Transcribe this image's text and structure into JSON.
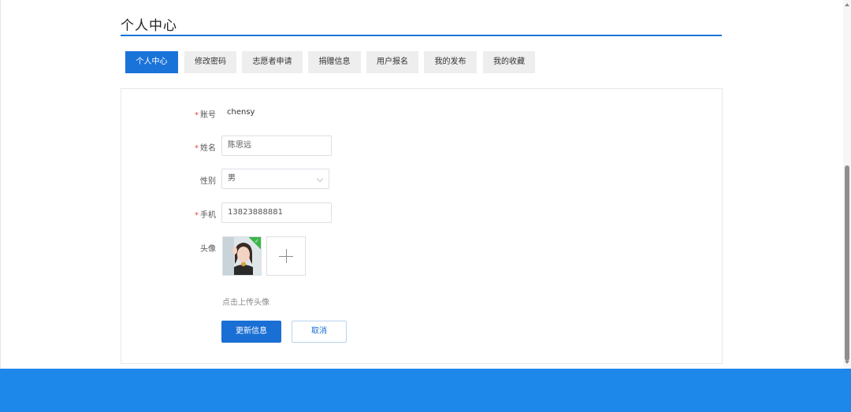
{
  "page": {
    "title": "个人中心"
  },
  "tabs": [
    {
      "label": "个人中心",
      "active": true
    },
    {
      "label": "修改密码",
      "active": false
    },
    {
      "label": "志愿者申请",
      "active": false
    },
    {
      "label": "捐赠信息",
      "active": false
    },
    {
      "label": "用户报名",
      "active": false
    },
    {
      "label": "我的发布",
      "active": false
    },
    {
      "label": "我的收藏",
      "active": false
    }
  ],
  "form": {
    "required_mark": "*",
    "account": {
      "label": "账号",
      "value": "chensy"
    },
    "name": {
      "label": "姓名",
      "value": "陈思远"
    },
    "gender": {
      "label": "性别",
      "value": "男"
    },
    "phone": {
      "label": "手机",
      "value": "13823888881"
    },
    "avatar": {
      "label": "头像",
      "hint": "点击上传头像"
    }
  },
  "buttons": {
    "update": "更新信息",
    "cancel": "取消"
  },
  "colors": {
    "accent": "#1a73d9",
    "footer": "#1d88ea",
    "required": "#e4493a",
    "success": "#3bb54a"
  },
  "icons": {
    "upload": "plus-icon",
    "uploaded": "check-icon",
    "select": "chevron-down-icon"
  }
}
